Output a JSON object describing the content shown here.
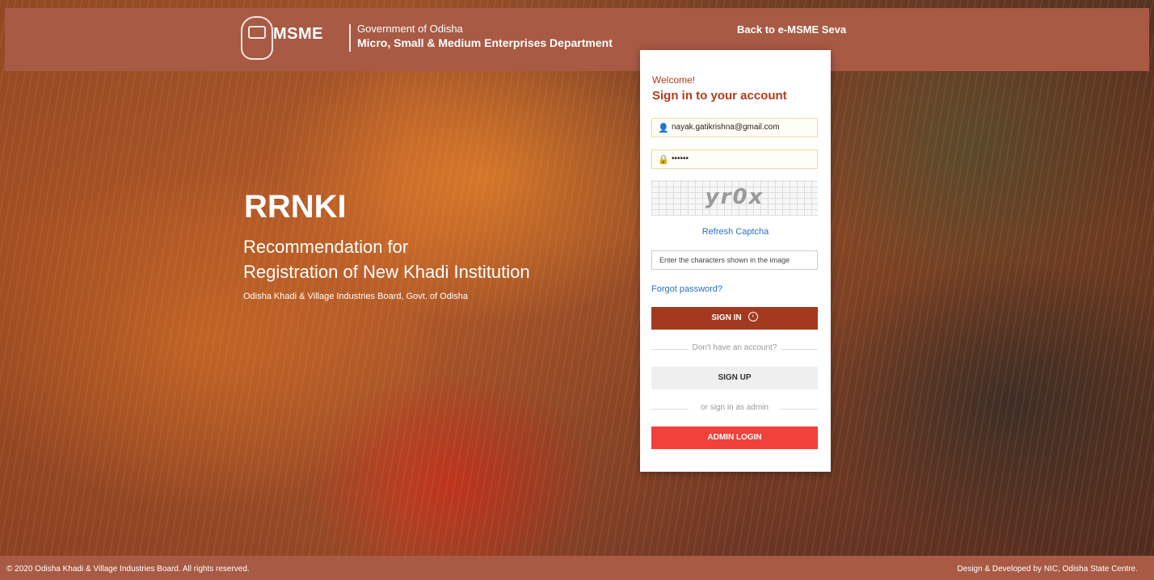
{
  "header": {
    "logo_text": "MSME",
    "gov_line": "Government of Odisha",
    "dept_line": "Micro, Small & Medium Enterprises Department",
    "back_link": "Back to e-MSME Seva"
  },
  "hero": {
    "title": "RRNKI",
    "subtitle_line1": "Recommendation for",
    "subtitle_line2": "Registration of New Khadi Institution",
    "org": "Odisha Khadi & Village Industries Board, Govt. of Odisha"
  },
  "login": {
    "welcome": "Welcome!",
    "title": "Sign in to your account",
    "username_value": "nayak.gatikrishna@gmail.com",
    "password_value": "••••••",
    "captcha_text": "yr0x",
    "refresh_label": "Refresh Captcha",
    "captcha_placeholder": "Enter the characters shown in the image",
    "forgot_label": "Forgot password?",
    "signin_label": "SIGN IN",
    "no_account_text": "Don't have an account?",
    "signup_label": "SIGN UP",
    "admin_sep_text": "or sign in as admin",
    "admin_label": "ADMIN LOGIN"
  },
  "footer": {
    "left": "© 2020 Odisha Khadi & Village Industries Board. All rights reserved.",
    "right": "Design & Developed by NIC, Odisha State Centre."
  },
  "colors": {
    "header_bg": "#a85a45",
    "accent": "#a33a1f",
    "admin": "#f2403a",
    "link": "#2a6fc2"
  }
}
